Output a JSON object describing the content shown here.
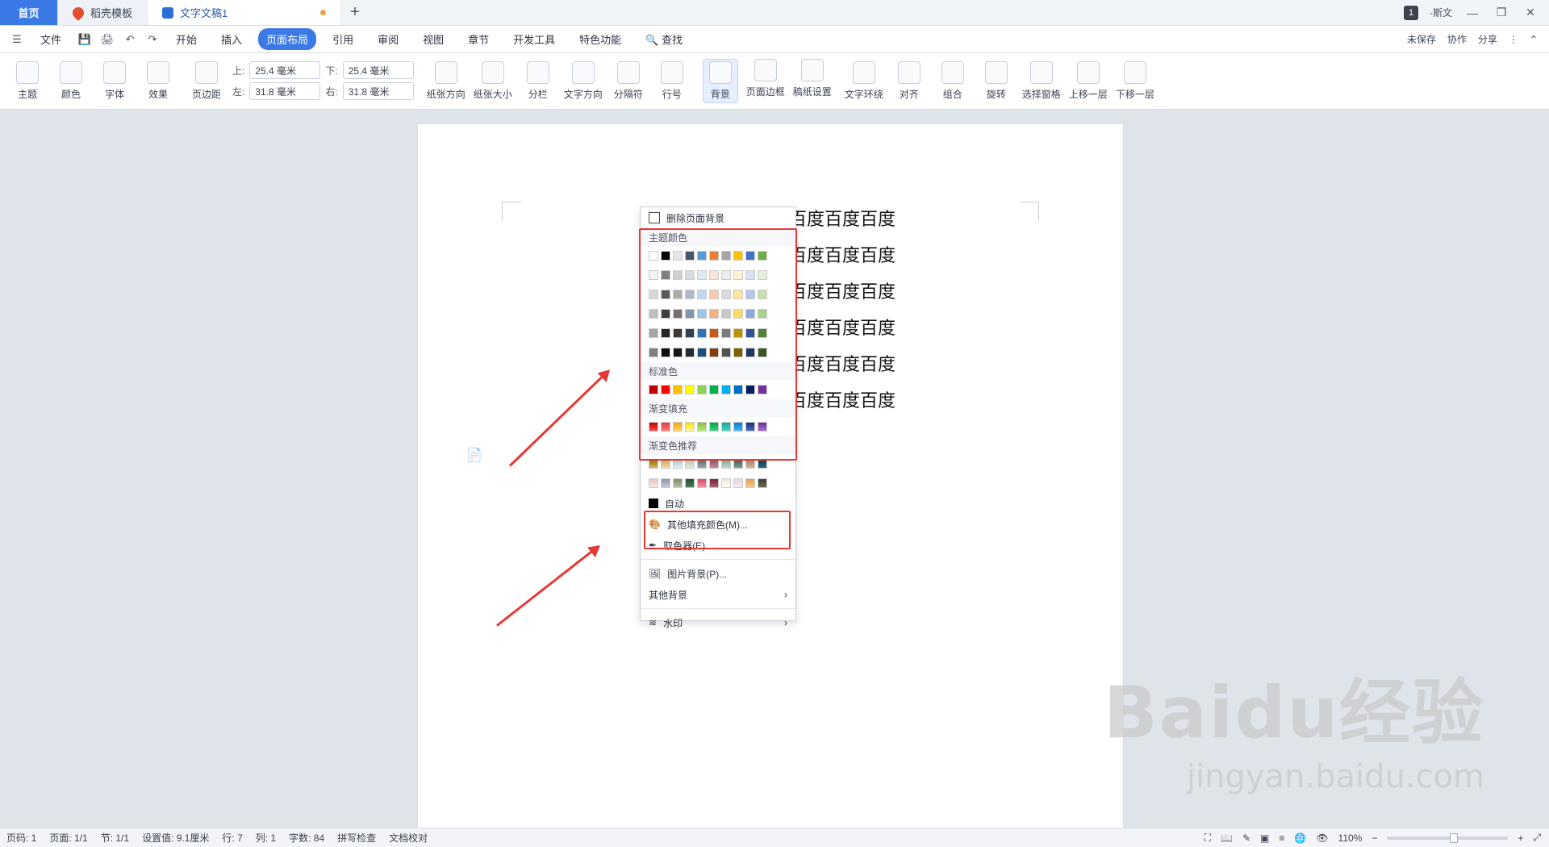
{
  "tabs": {
    "home": "首页",
    "template": "稻壳模板",
    "doc": "文字文稿1",
    "add": "+"
  },
  "user": {
    "name": "-斯文",
    "badge": "1"
  },
  "menu": {
    "file": "文件",
    "start": "开始",
    "insert": "插入",
    "layout": "页面布局",
    "ref": "引用",
    "review": "审阅",
    "view": "视图",
    "section": "章节",
    "dev": "开发工具",
    "feature": "特色功能",
    "search": "查找",
    "unsaved": "未保存",
    "collab": "协作",
    "share": "分享"
  },
  "ribbon": {
    "theme": "主题",
    "color": "颜色",
    "font": "字体",
    "effect": "效果",
    "margin": "页边距",
    "top_label": "上:",
    "top_value": "25.4 毫米",
    "bottom_label": "下:",
    "bottom_value": "25.4 毫米",
    "left_label": "左:",
    "left_value": "31.8 毫米",
    "right_label": "右:",
    "right_value": "31.8 毫米",
    "orientation": "纸张方向",
    "size": "纸张大小",
    "columns": "分栏",
    "text_dir": "文字方向",
    "separator": "分隔符",
    "line_no": "行号",
    "background": "背景",
    "page_border": "页面边框",
    "paper_setting": "稿纸设置",
    "wrap": "文字环绕",
    "align": "对齐",
    "group": "组合",
    "rotate": "旋转",
    "select_pane": "选择窗格",
    "bring_up": "上移一层",
    "send_down": "下移一层"
  },
  "dropdown": {
    "delete_bg": "删除页面背景",
    "theme_colors": "主题颜色",
    "standard_colors": "标准色",
    "gradient_fill": "渐变填充",
    "gradient_reco": "渐变色推荐",
    "auto": "自动",
    "more_fill": "其他填充颜色(M)...",
    "picker": "取色器(E)",
    "picture_bg": "图片背景(P)...",
    "other_bg": "其他背景",
    "watermark": "水印"
  },
  "document": {
    "line1": "百度百度百度",
    "line2": "百度百度百度",
    "line3": "百度百度百度",
    "line4": "百度百度百度",
    "line5": "百度百度百度",
    "line6": "百度百度百度"
  },
  "status": {
    "page": "页码: 1",
    "pages": "页面: 1/1",
    "section": "节: 1/1",
    "setting": "设置值: 9.1厘米",
    "row": "行: 7",
    "col": "列: 1",
    "words": "字数: 84",
    "spell": "拼写检查",
    "proof": "文档校对",
    "zoom": "110%",
    "zoom_level": 0.55
  },
  "watermark": {
    "brand": "Baidu经验",
    "url": "jingyan.baidu.com"
  },
  "colors": {
    "accent": "#2b6fd6",
    "highlight": "#e53935"
  }
}
